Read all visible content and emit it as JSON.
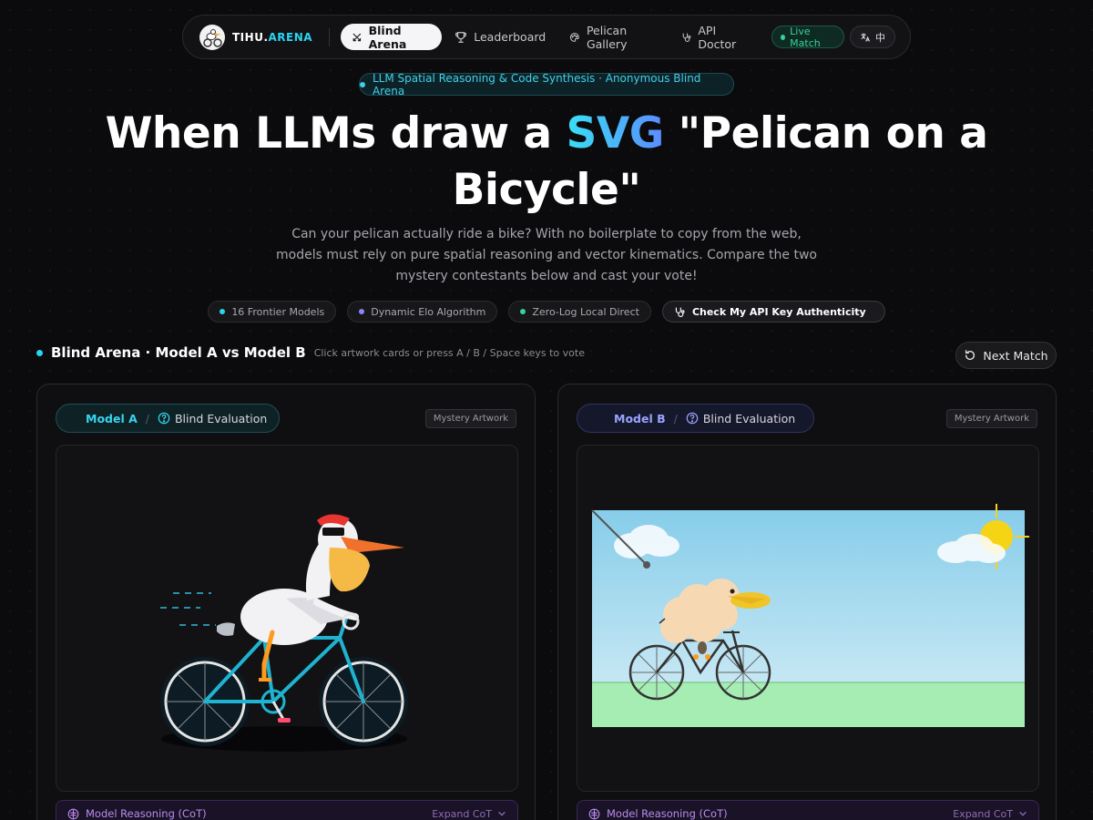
{
  "nav": {
    "brand_prefix": "TIHU.",
    "brand_suffix": "ARENA",
    "items": [
      {
        "label": "Blind Arena",
        "icon": "swords-icon",
        "active": true
      },
      {
        "label": "Leaderboard",
        "icon": "trophy-icon",
        "active": false
      },
      {
        "label": "Pelican Gallery",
        "icon": "palette-icon",
        "active": false
      },
      {
        "label": "API Doctor",
        "icon": "stethoscope-icon",
        "active": false
      }
    ],
    "live_label": "Live Match",
    "lang_label": "中"
  },
  "hero": {
    "tagline": "LLM Spatial Reasoning & Code Synthesis · Anonymous Blind Arena",
    "title_part1": "When LLMs draw a ",
    "title_highlight": "SVG",
    "title_part2": " \"Pelican on a Bicycle\"",
    "subtitle": "Can your pelican actually ride a bike? With no boilerplate to copy from the web, models must rely on pure spatial reasoning and vector kinematics. Compare the two mystery contestants below and cast your vote!",
    "chips": [
      {
        "label": "16 Frontier Models",
        "color": "#2bd4f0"
      },
      {
        "label": "Dynamic Elo Algorithm",
        "color": "#8b86f5"
      },
      {
        "label": "Zero-Log Local Direct",
        "color": "#35d39a"
      }
    ],
    "action_chip": "Check My API Key Authenticity"
  },
  "arena": {
    "title": "Blind Arena · Model A vs Model B",
    "hint": "Click artwork cards or press A / B / Space keys to vote",
    "next_label": "Next Match"
  },
  "cards": {
    "a": {
      "model": "Model A",
      "separator": "/",
      "eval_label": "Blind Evaluation",
      "badge": "Mystery Artwork",
      "cot_label": "Model Reasoning (CoT)",
      "cot_expand": "Expand CoT"
    },
    "b": {
      "model": "Model B",
      "separator": "/",
      "eval_label": "Blind Evaluation",
      "badge": "Mystery Artwork",
      "cot_label": "Model Reasoning (CoT)",
      "cot_expand": "Expand CoT"
    }
  },
  "colors": {
    "accent_cyan": "#2bd4f0",
    "accent_indigo": "#9aa3ff",
    "live_green": "#35d39a",
    "cot_purple": "#b98cf0"
  }
}
